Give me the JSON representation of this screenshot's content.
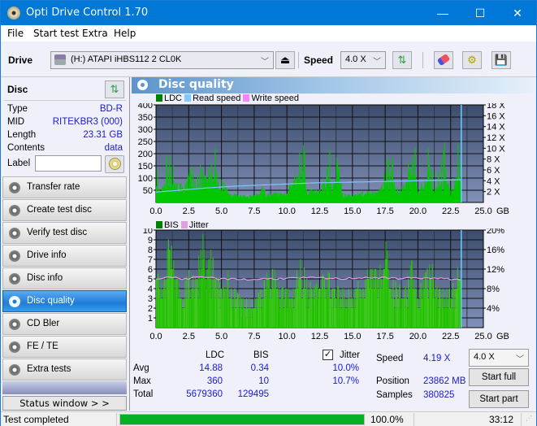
{
  "window": {
    "title": "Opti Drive Control 1.70",
    "minimize": "—",
    "maximize": "☐",
    "close": "✕"
  },
  "menu": [
    "File",
    "Start test",
    "Extra",
    "Help"
  ],
  "toolbar": {
    "drive_label": "Drive",
    "drive_value": "(H:)  ATAPI iHBS112  2 CL0K",
    "speed_label": "Speed",
    "speed_value": "4.0 X"
  },
  "disc": {
    "header": "Disc",
    "fields": [
      {
        "label": "Type",
        "value": "BD-R"
      },
      {
        "label": "MID",
        "value": "RITEKBR3 (000)"
      },
      {
        "label": "Length",
        "value": "23.31 GB"
      },
      {
        "label": "Contents",
        "value": "data"
      }
    ],
    "label_field": "Label",
    "label_value": ""
  },
  "nav": [
    {
      "label": "Transfer rate",
      "active": false
    },
    {
      "label": "Create test disc",
      "active": false
    },
    {
      "label": "Verify test disc",
      "active": false
    },
    {
      "label": "Drive info",
      "active": false
    },
    {
      "label": "Disc info",
      "active": false
    },
    {
      "label": "Disc quality",
      "active": true
    },
    {
      "label": "CD Bler",
      "active": false
    },
    {
      "label": "FE / TE",
      "active": false
    },
    {
      "label": "Extra tests",
      "active": false
    }
  ],
  "status_window_button": "Status window > >",
  "panel_title": "Disc quality",
  "chart_data": [
    {
      "type": "area",
      "title": "LDC / Read speed",
      "legend": [
        "LDC",
        "Read speed",
        "Write speed"
      ],
      "legend_colors": [
        "#008000",
        "#80c8ff",
        "#ff80ff"
      ],
      "xlabel": "GB",
      "xlim": [
        0,
        25
      ],
      "x_ticks": [
        "0.0",
        "2.5",
        "5.0",
        "7.5",
        "10.0",
        "12.5",
        "15.0",
        "17.5",
        "20.0",
        "22.5",
        "25.0"
      ],
      "ylim_left": [
        0,
        400
      ],
      "y_ticks_left": [
        "50",
        "100",
        "150",
        "200",
        "250",
        "300",
        "350",
        "400"
      ],
      "ylim_right": [
        0,
        18
      ],
      "y_ticks_right": [
        "2 X",
        "4 X",
        "6 X",
        "8 X",
        "10 X",
        "12 X",
        "14 X",
        "16 X",
        "18 X"
      ],
      "grid": true,
      "end_marker_gb": 23.31,
      "ldc_profile": [
        [
          0.0,
          340
        ],
        [
          0.1,
          90
        ],
        [
          0.5,
          85
        ],
        [
          0.8,
          260
        ],
        [
          1.0,
          290
        ],
        [
          1.2,
          170
        ],
        [
          1.5,
          120
        ],
        [
          1.8,
          90
        ],
        [
          2.0,
          95
        ],
        [
          2.2,
          110
        ],
        [
          2.4,
          150
        ],
        [
          2.5,
          260
        ],
        [
          2.8,
          150
        ],
        [
          3.2,
          160
        ],
        [
          3.5,
          200
        ],
        [
          3.8,
          190
        ],
        [
          4.2,
          200
        ],
        [
          4.5,
          265
        ],
        [
          4.6,
          130
        ],
        [
          5.0,
          120
        ],
        [
          5.4,
          90
        ],
        [
          5.6,
          40
        ],
        [
          6.5,
          35
        ],
        [
          7.0,
          30
        ],
        [
          7.5,
          35
        ],
        [
          8.0,
          45
        ],
        [
          8.1,
          230
        ],
        [
          8.3,
          40
        ],
        [
          10.0,
          45
        ],
        [
          11.3,
          290
        ],
        [
          11.5,
          50
        ],
        [
          12.4,
          60
        ],
        [
          12.6,
          50
        ],
        [
          13.2,
          300
        ],
        [
          13.4,
          50
        ],
        [
          14.0,
          280
        ],
        [
          14.2,
          40
        ],
        [
          15.0,
          30
        ],
        [
          15.5,
          45
        ],
        [
          17.0,
          50
        ],
        [
          17.5,
          180
        ],
        [
          18.0,
          240
        ],
        [
          18.5,
          40
        ],
        [
          19.5,
          250
        ],
        [
          19.7,
          320
        ],
        [
          20.0,
          45
        ],
        [
          21.0,
          320
        ],
        [
          21.2,
          40
        ],
        [
          22.0,
          250
        ],
        [
          22.5,
          30
        ],
        [
          23.0,
          260
        ],
        [
          23.2,
          350
        ],
        [
          23.31,
          0
        ]
      ],
      "read_speed_profile": [
        [
          0.0,
          1.9
        ],
        [
          2.0,
          2.3
        ],
        [
          4.0,
          2.7
        ],
        [
          6.0,
          3.0
        ],
        [
          8.0,
          3.2
        ],
        [
          10.0,
          3.4
        ],
        [
          12.0,
          3.6
        ],
        [
          14.0,
          3.7
        ],
        [
          16.0,
          3.8
        ],
        [
          18.0,
          3.9
        ],
        [
          20.0,
          4.0
        ],
        [
          22.0,
          4.1
        ],
        [
          23.31,
          4.2
        ]
      ]
    },
    {
      "type": "area",
      "title": "BIS / Jitter",
      "legend": [
        "BIS",
        "Jitter"
      ],
      "legend_colors": [
        "#008000",
        "#e0a0e0"
      ],
      "xlabel": "GB",
      "xlim": [
        0,
        25
      ],
      "x_ticks": [
        "0.0",
        "2.5",
        "5.0",
        "7.5",
        "10.0",
        "12.5",
        "15.0",
        "17.5",
        "20.0",
        "22.5",
        "25.0"
      ],
      "ylim_left": [
        0,
        10
      ],
      "y_ticks_left": [
        "1",
        "2",
        "3",
        "4",
        "5",
        "6",
        "7",
        "8",
        "9",
        "10"
      ],
      "ylim_right": [
        0,
        20
      ],
      "y_ticks_right": [
        "4%",
        "8%",
        "12%",
        "16%",
        "20%"
      ],
      "grid": true,
      "end_marker_gb": 23.31,
      "bis_profile": [
        [
          0.0,
          6
        ],
        [
          0.5,
          4
        ],
        [
          1.0,
          10
        ],
        [
          1.3,
          7
        ],
        [
          2.0,
          4
        ],
        [
          2.5,
          6
        ],
        [
          3.0,
          5
        ],
        [
          3.5,
          10
        ],
        [
          3.8,
          8
        ],
        [
          4.2,
          8
        ],
        [
          4.5,
          6
        ],
        [
          5.0,
          4
        ],
        [
          5.5,
          6
        ],
        [
          6.0,
          4
        ],
        [
          6.5,
          3
        ],
        [
          7.5,
          3
        ],
        [
          8.0,
          4
        ],
        [
          8.8,
          7
        ],
        [
          9.5,
          4
        ],
        [
          10.5,
          5
        ],
        [
          11.0,
          7
        ],
        [
          12.0,
          4
        ],
        [
          13.0,
          6
        ],
        [
          14.0,
          4
        ],
        [
          15.0,
          4
        ],
        [
          16.0,
          6
        ],
        [
          17.0,
          6
        ],
        [
          17.5,
          9
        ],
        [
          18.0,
          5
        ],
        [
          19.0,
          4
        ],
        [
          19.5,
          7
        ],
        [
          20.0,
          4
        ],
        [
          21.0,
          7
        ],
        [
          21.5,
          4
        ],
        [
          22.5,
          4
        ],
        [
          23.2,
          7
        ],
        [
          23.31,
          0
        ]
      ],
      "jitter_percent_profile": [
        [
          0.0,
          10.1
        ],
        [
          1.0,
          10.4
        ],
        [
          2.0,
          10.0
        ],
        [
          3.0,
          10.2
        ],
        [
          4.0,
          10.3
        ],
        [
          5.0,
          9.9
        ],
        [
          6.0,
          10.1
        ],
        [
          7.0,
          9.8
        ],
        [
          8.0,
          10.0
        ],
        [
          10.0,
          10.1
        ],
        [
          12.0,
          10.2
        ],
        [
          14.0,
          10.0
        ],
        [
          16.0,
          10.3
        ],
        [
          18.0,
          10.1
        ],
        [
          20.0,
          10.2
        ],
        [
          22.0,
          10.0
        ],
        [
          23.3,
          9.9
        ]
      ]
    }
  ],
  "stats": {
    "col_ldc": "LDC",
    "col_bis": "BIS",
    "jitter_checked": true,
    "jitter_label": "Jitter",
    "rows": [
      {
        "label": "Avg",
        "ldc": "14.88",
        "bis": "0.34",
        "jitter": "10.0%"
      },
      {
        "label": "Max",
        "ldc": "360",
        "bis": "10",
        "jitter": "10.7%"
      },
      {
        "label": "Total",
        "ldc": "5679360",
        "bis": "129495",
        "jitter": ""
      }
    ],
    "speed_label": "Speed",
    "speed_value": "4.19 X",
    "position_label": "Position",
    "position_value": "23862 MB",
    "samples_label": "Samples",
    "samples_value": "380825",
    "speed_select": "4.0 X",
    "start_full": "Start full",
    "start_part": "Start part"
  },
  "statusbar": {
    "text": "Test completed",
    "progress_percent": 100.0,
    "progress_text": "100.0%",
    "time": "33:12"
  },
  "colors": {
    "titlebar": "#0078d7",
    "ldc": "#00c800",
    "read_speed": "#80c8ff",
    "jitter": "#e0a0e0",
    "progress": "#06b025",
    "value_text": "#1a1ad0"
  }
}
